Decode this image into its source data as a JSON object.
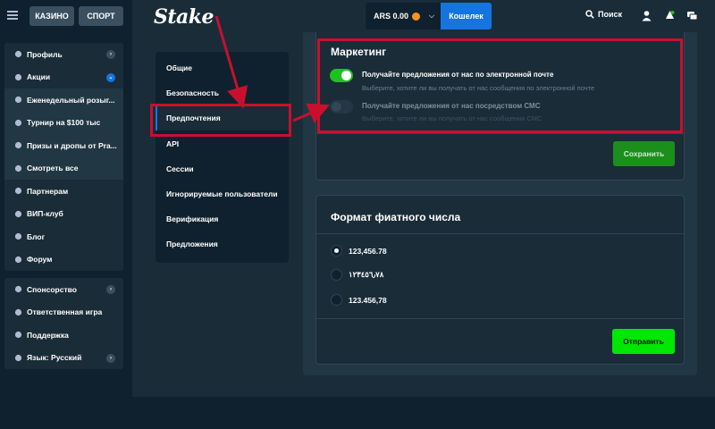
{
  "topbar": {
    "casino_label": "КАЗИНО",
    "sport_label": "СПОРТ",
    "logo": "Stake",
    "balance": "ARS 0.00",
    "wallet_label": "Кошелек",
    "search_label": "Поиск"
  },
  "sidebar": {
    "group1": [
      {
        "label": "Профиль",
        "icon": "user-icon",
        "arrow": "right"
      },
      {
        "label": "Акции",
        "icon": "gift-icon",
        "arrow": "down"
      },
      {
        "label": "Еженедельный розыг...",
        "icon": "calendar-icon"
      },
      {
        "label": "Турнир на $100 тыс",
        "icon": "trophy-icon"
      },
      {
        "label": "Призы и дропы от Pra...",
        "icon": "trophy-icon"
      },
      {
        "label": "Смотреть все",
        "icon": "gift-icon"
      },
      {
        "label": "Партнерам",
        "icon": "handshake-icon"
      },
      {
        "label": "ВИП-клуб",
        "icon": "trophy-icon"
      },
      {
        "label": "Блог",
        "icon": "document-icon"
      },
      {
        "label": "Форум",
        "icon": "chat-icon"
      }
    ],
    "group2": [
      {
        "label": "Спонсорство",
        "icon": "sponsor-icon",
        "arrow": "right"
      },
      {
        "label": "Ответственная игра",
        "icon": "shield-icon"
      },
      {
        "label": "Поддержка",
        "icon": "headset-icon"
      },
      {
        "label": "Язык: Русский",
        "icon": "globe-icon",
        "arrow": "right"
      }
    ]
  },
  "settings_nav": [
    {
      "label": "Общие"
    },
    {
      "label": "Безопасность"
    },
    {
      "label": "Предпочтения",
      "active": true
    },
    {
      "label": "API"
    },
    {
      "label": "Сессии"
    },
    {
      "label": "Игнорируемые пользователи"
    },
    {
      "label": "Верификация"
    },
    {
      "label": "Предложения"
    }
  ],
  "marketing": {
    "title": "Маркетинг",
    "email_title": "Получайте предложения от нас по электронной почте",
    "email_desc": "Выберите, хотите ли вы получать от нас сообщения по электронной почте",
    "email_enabled": true,
    "sms_title": "Получайте предложения от нас посредством СМС",
    "sms_desc": "Выберите, хотите ли вы получать от нас сообщения СМС",
    "sms_enabled": false,
    "save_label": "Сохранить"
  },
  "format": {
    "title": "Формат фиатного числа",
    "options": [
      {
        "label": "123,456.78",
        "selected": true
      },
      {
        "label": "١٢٣٤٥٦٫٧٨",
        "selected": false
      },
      {
        "label": "123.456,78",
        "selected": false
      }
    ],
    "submit_label": "Отправить"
  },
  "colors": {
    "accent_blue": "#1475e1",
    "green": "#1fc11f",
    "highlight_red": "#c8102e"
  }
}
